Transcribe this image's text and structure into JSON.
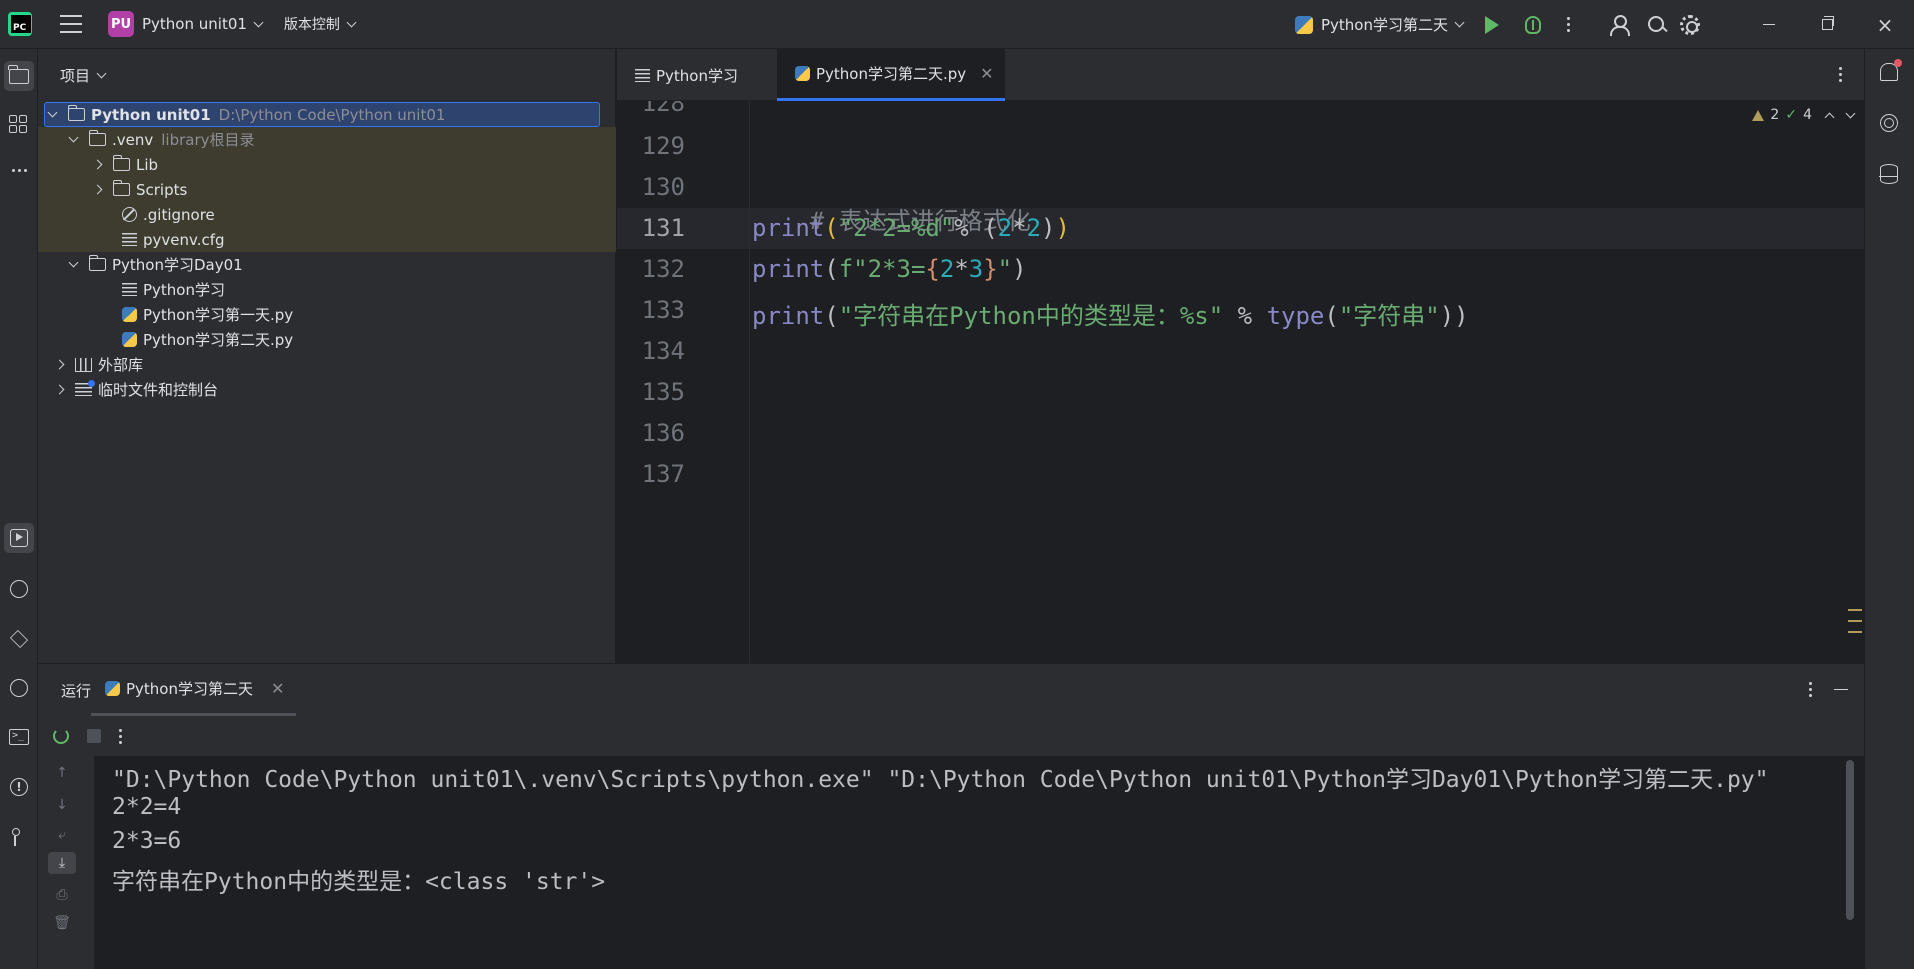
{
  "titlebar": {
    "project_badge": "PU",
    "project_name": "Python unit01",
    "vcs": "版本控制",
    "run_config": "Python学习第二天"
  },
  "project_panel": {
    "header": "项目",
    "tree": [
      {
        "name": "Python unit01",
        "path": "D:\\Python Code\\Python unit01"
      },
      {
        "name": ".venv",
        "path": "library根目录"
      },
      {
        "name": "Lib"
      },
      {
        "name": "Scripts"
      },
      {
        "name": ".gitignore"
      },
      {
        "name": "pyvenv.cfg"
      },
      {
        "name": "Python学习Day01"
      },
      {
        "name": "Python学习"
      },
      {
        "name": "Python学习第一天.py"
      },
      {
        "name": "Python学习第二天.py"
      },
      {
        "name": "外部库"
      },
      {
        "name": "临时文件和控制台"
      }
    ]
  },
  "editor": {
    "tabs": [
      {
        "label": "Python学习"
      },
      {
        "label": "Python学习第二天.py"
      }
    ],
    "inspections": {
      "warnings": "2",
      "ok": "4"
    },
    "line_numbers": [
      "128",
      "129",
      "130",
      "131",
      "132",
      "133",
      "134",
      "135",
      "136",
      "137"
    ],
    "code": {
      "l130": "# 表达式进行格式化",
      "l131": {
        "fn": "print",
        "open": "(",
        "str": "\"2*2=%d\"",
        "op": "% (",
        "n1": "2",
        "star": "*",
        "n2": "2",
        "close_inner": ")",
        "close": ")"
      },
      "l132": {
        "fn": "print",
        "open": "(",
        "str_a": "f\"2*3=",
        "brace_open": "{",
        "n1": "2",
        "star": "*",
        "n2": "3",
        "brace_close": "}",
        "str_b": "\"",
        "close": ")"
      },
      "l133": {
        "fn": "print",
        "open": "(",
        "str": "\"字符串在Python中的类型是：%s\"",
        "op": " % ",
        "fn2": "type",
        "open2": "(",
        "str2": "\"字符串\"",
        "close": "))"
      }
    }
  },
  "run_panel": {
    "title": "运行",
    "tab": "Python学习第二天",
    "output": [
      "\"D:\\Python Code\\Python unit01\\.venv\\Scripts\\python.exe\" \"D:\\Python Code\\Python unit01\\Python学习Day01\\Python学习第二天.py\"",
      "2*2=4",
      "2*3=6",
      "字符串在Python中的类型是：<class 'str'>"
    ]
  },
  "icons": {
    "close": "×",
    "close_tab": "✕"
  },
  "colors": {
    "accent": "#3574f0",
    "run_green": "#5fb865",
    "project_badge": "#b13fa5"
  }
}
